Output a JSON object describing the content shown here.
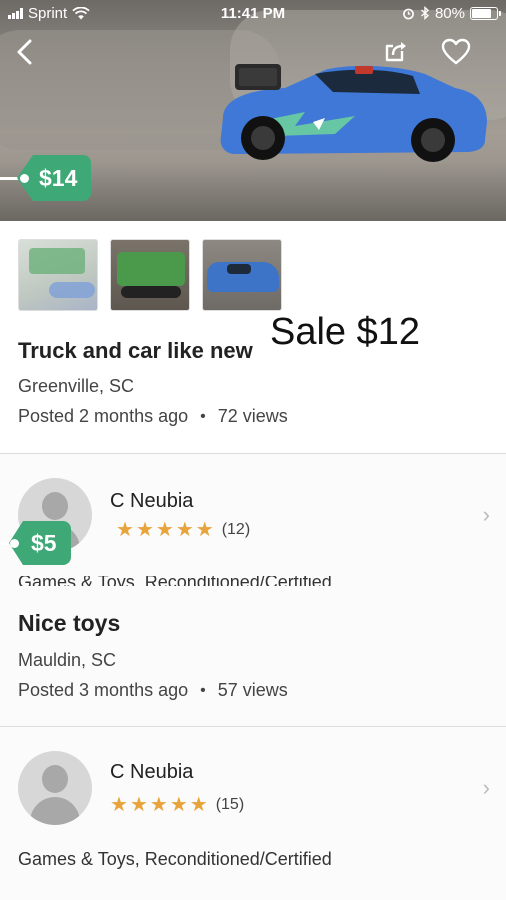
{
  "status_bar": {
    "carrier": "Sprint",
    "time": "11:41 PM",
    "battery": "80%",
    "battery_level": 0.8,
    "icons": [
      "signal-icon",
      "wifi-icon",
      "alarm-icon",
      "bluetooth-icon",
      "battery-icon"
    ]
  },
  "hero": {
    "price": "$14",
    "back_icon": "back-chevron-icon",
    "share_icon": "share-icon",
    "favorite_icon": "heart-icon"
  },
  "listing": {
    "title": "Truck and car like new",
    "sale_note": "Sale $12",
    "location": "Greenville, SC",
    "posted": "Posted 2 months ago",
    "separator": "•",
    "views": "72 views"
  },
  "seller1": {
    "name": "C Neubia",
    "rating": 5,
    "rating_count": "(12)",
    "category": "Games & Toys, Reconditioned/Certified"
  },
  "listing2": {
    "price": "$5",
    "title": "Nice toys",
    "location": "Mauldin, SC",
    "posted": "Posted 3 months ago",
    "separator": "•",
    "views": "57 views"
  },
  "seller2": {
    "name": "C Neubia",
    "rating": 5,
    "rating_count": "(15)",
    "category": "Games & Toys, Reconditioned/Certified"
  },
  "colors": {
    "price_tag": "#3fa877",
    "star": "#e8a33a"
  }
}
